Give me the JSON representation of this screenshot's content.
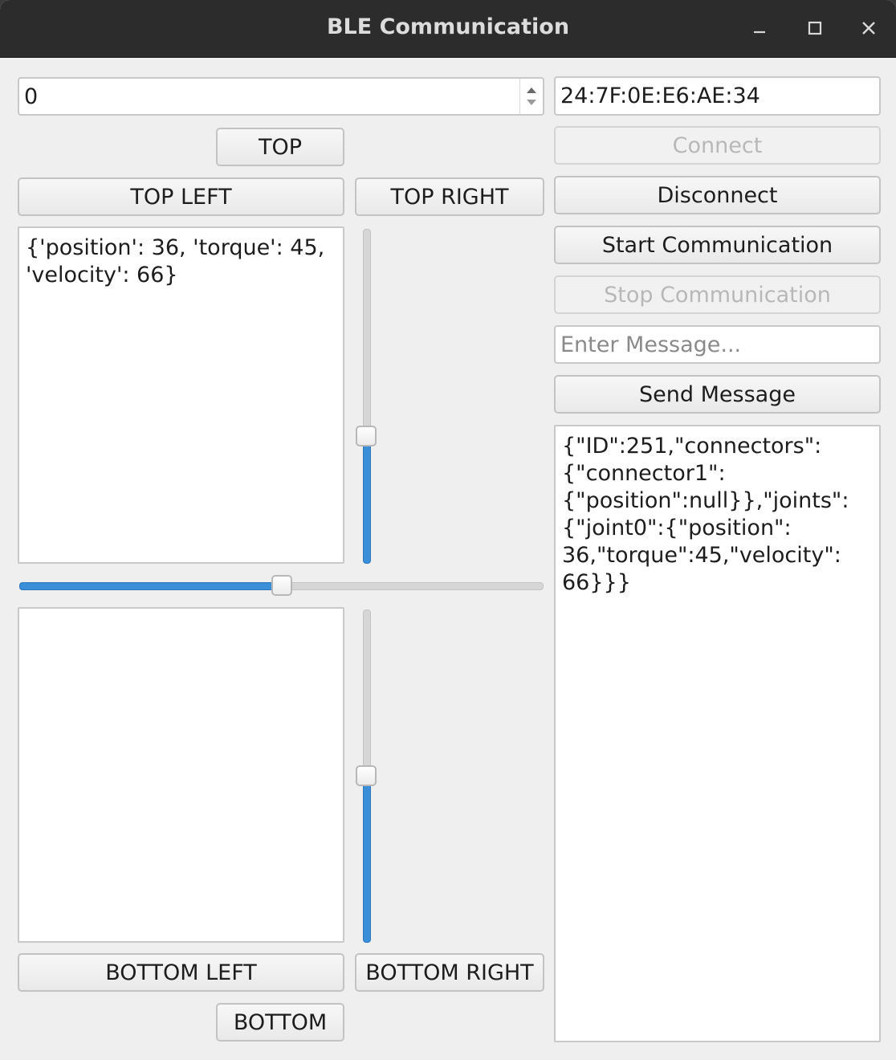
{
  "window": {
    "title": "BLE Communication",
    "minimize_icon": "minimize-icon",
    "maximize_icon": "maximize-icon",
    "close_icon": "close-icon"
  },
  "left": {
    "spinbox_value": "0",
    "buttons": {
      "top": "TOP",
      "top_left": "TOP LEFT",
      "top_right": "TOP RIGHT",
      "bottom_left": "BOTTOM LEFT",
      "bottom_right": "BOTTOM RIGHT",
      "bottom": "BOTTOM"
    },
    "top_output": "{'position': 36, 'torque': 45, 'velocity': 66}",
    "bottom_output": "",
    "sliders": {
      "top_vertical_fraction": 0.38,
      "horizontal_fraction": 0.5,
      "bottom_vertical_fraction": 0.5
    }
  },
  "right": {
    "address": "24:7F:0E:E6:AE:34",
    "connect_label": "Connect",
    "disconnect_label": "Disconnect",
    "start_label": "Start Communication",
    "stop_label": "Stop Communication",
    "message_placeholder": "Enter Message...",
    "send_label": "Send Message",
    "log_output": "{\"ID\":251,\"connectors\":\n{\"connector1\":\n{\"position\":null}},\"joints\":\n{\"joint0\":{\"position\":\n36,\"torque\":45,\"velocity\":\n66}}}"
  },
  "colors": {
    "accent": "#3a8fd8",
    "titlebar": "#2c2c2c",
    "window_bg": "#efefef"
  }
}
